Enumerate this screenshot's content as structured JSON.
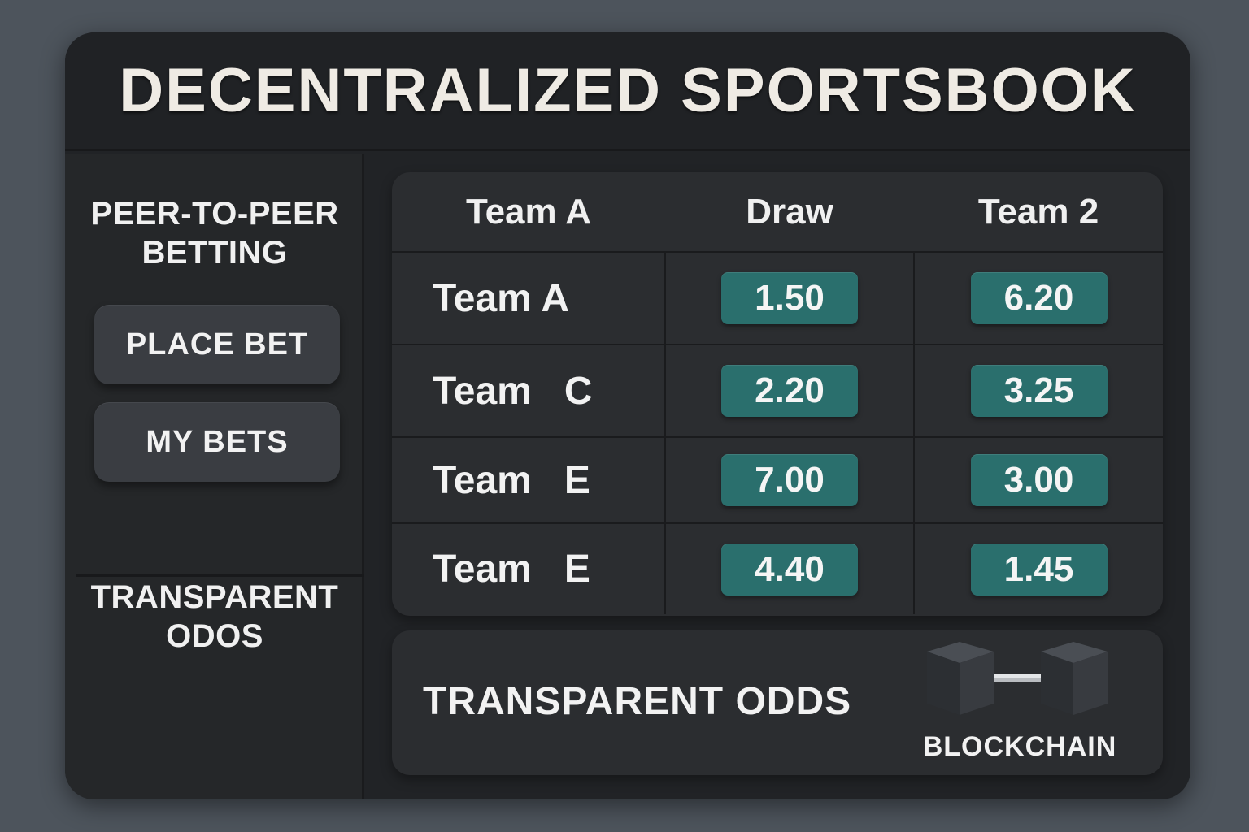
{
  "header": {
    "title": "DECENTRALIZED SPORTSBOOK"
  },
  "sidebar": {
    "heading_top": "PEER-TO-PEER\nBETTING",
    "buttons": [
      {
        "label": "PLACE BET"
      },
      {
        "label": "MY BETS"
      }
    ],
    "heading_bottom": "TRANSPARENT\nODOS"
  },
  "odds_table": {
    "columns": [
      "Team A",
      "Draw",
      "Team 2"
    ],
    "rows": [
      {
        "team": "Team A",
        "draw": "1.50",
        "team2": "6.20"
      },
      {
        "team": "Team   C",
        "draw": "2.20",
        "team2": "3.25"
      },
      {
        "team": "Team   E",
        "draw": "7.00",
        "team2": "3.00"
      },
      {
        "team": "Team   E",
        "draw": "4.40",
        "team2": "1.45"
      }
    ]
  },
  "footer": {
    "text": "TRANSPARENT ODDS",
    "blockchain_label": "BLOCKCHAIN",
    "icon": "blockchain-icon"
  },
  "colors": {
    "background": "#4d545c",
    "panel": "#212326",
    "odds_pill": "#2a6f6d",
    "button": "#3a3d42"
  }
}
